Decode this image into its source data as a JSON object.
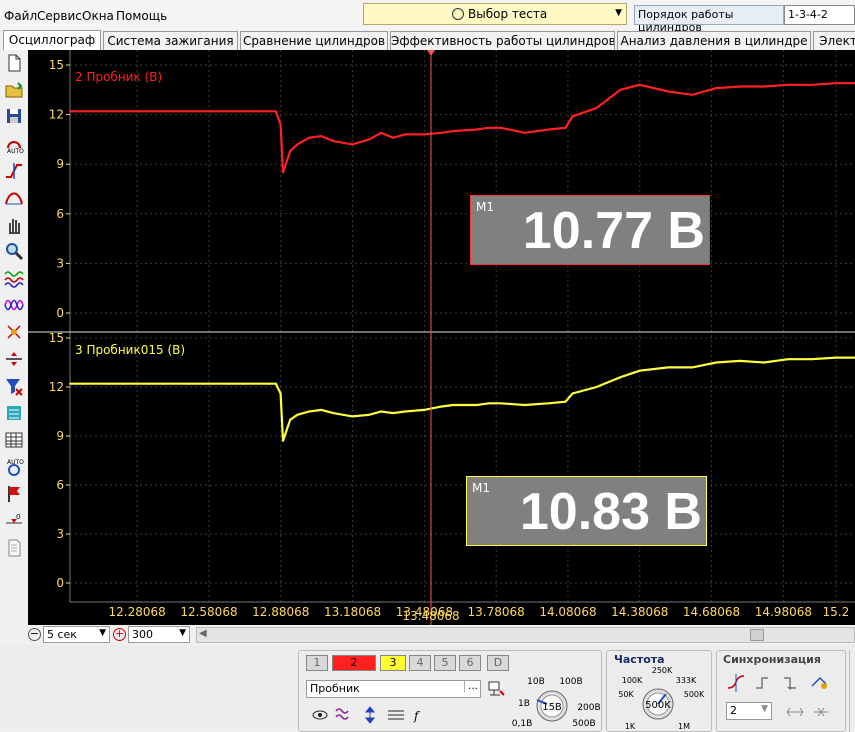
{
  "menu": {
    "file": "Файл",
    "service": "Сервис",
    "windows": "Окна",
    "help": "Помощь"
  },
  "test_select": {
    "label": "Выбор теста"
  },
  "cylinder_order": {
    "label": "Порядок работы цилиндров",
    "value": "1-3-4-2"
  },
  "tabs": [
    "Осциллограф",
    "Система зажигания",
    "Сравнение цилиндров",
    "Эффективность работы цилиндров",
    "Анализ давления в цилиндре",
    "Элект"
  ],
  "active_tab_index": 0,
  "channels": [
    {
      "name": "2 Пробник (В)",
      "color": "#ff2020",
      "marker": "M1",
      "value": "10.77 В"
    },
    {
      "name": "3 Пробник015 (В)",
      "color": "#ffff40",
      "marker": "M1",
      "value": "10.83 В"
    }
  ],
  "y_ticks": [
    "15",
    "12",
    "9",
    "6",
    "3",
    "0"
  ],
  "chart_data": [
    {
      "type": "line",
      "name": "2 Пробник (В)",
      "ylim": [
        0,
        15
      ],
      "xlim": [
        12.0,
        15.28
      ],
      "x_ticks": [
        "12.28068",
        "12.58068",
        "12.88068",
        "13.18068",
        "13.48068",
        "13.78068",
        "14.08068",
        "14.38068",
        "14.68068",
        "14.98068",
        "15.2"
      ],
      "x": [
        12.0,
        12.86,
        12.88,
        12.89,
        12.92,
        12.95,
        13.0,
        13.05,
        13.1,
        13.18,
        13.25,
        13.3,
        13.35,
        13.4,
        13.48,
        13.55,
        13.6,
        13.7,
        13.75,
        13.8,
        13.9,
        14.0,
        14.07,
        14.1,
        14.2,
        14.3,
        14.38,
        14.5,
        14.6,
        14.7,
        14.8,
        14.9,
        15.0,
        15.1,
        15.2,
        15.28
      ],
      "y": [
        12.2,
        12.2,
        11.4,
        8.5,
        9.8,
        10.2,
        10.6,
        10.7,
        10.4,
        10.2,
        10.5,
        10.9,
        10.6,
        10.8,
        10.8,
        10.9,
        11.0,
        11.1,
        11.2,
        11.2,
        10.9,
        11.1,
        11.2,
        11.9,
        12.4,
        13.5,
        13.8,
        13.4,
        13.2,
        13.6,
        13.7,
        13.7,
        13.8,
        13.8,
        13.9,
        13.9
      ]
    },
    {
      "type": "line",
      "name": "3 Пробник015 (В)",
      "ylim": [
        0,
        15
      ],
      "xlim": [
        12.0,
        15.28
      ],
      "x_ticks": [
        "12.28068",
        "12.58068",
        "12.88068",
        "13.18068",
        "13.48068",
        "13.78068",
        "14.08068",
        "14.38068",
        "14.68068",
        "14.98068",
        "15.2"
      ],
      "x": [
        12.0,
        12.86,
        12.88,
        12.89,
        12.92,
        12.95,
        13.0,
        13.05,
        13.1,
        13.18,
        13.25,
        13.3,
        13.35,
        13.4,
        13.48,
        13.55,
        13.6,
        13.7,
        13.75,
        13.8,
        13.9,
        14.0,
        14.07,
        14.1,
        14.2,
        14.3,
        14.38,
        14.5,
        14.6,
        14.7,
        14.8,
        14.9,
        15.0,
        15.1,
        15.2,
        15.28
      ],
      "y": [
        12.2,
        12.2,
        11.6,
        8.7,
        10.0,
        10.3,
        10.5,
        10.6,
        10.4,
        10.2,
        10.3,
        10.5,
        10.4,
        10.5,
        10.6,
        10.8,
        10.9,
        10.9,
        11.0,
        11.0,
        10.9,
        11.0,
        11.1,
        11.6,
        12.0,
        12.6,
        13.0,
        13.2,
        13.2,
        13.5,
        13.6,
        13.5,
        13.7,
        13.7,
        13.8,
        13.8
      ]
    }
  ],
  "cursor_time": "13.48068",
  "bottom_bar": {
    "timebase": "5 сек",
    "count": "300"
  },
  "channel_buttons": [
    "1",
    "2",
    "3",
    "4",
    "5",
    "6",
    "D"
  ],
  "probe_field": {
    "value": "Пробник"
  },
  "panel": {
    "frequency_title": "Частота",
    "sync_title": "Синхронизация",
    "volt_knob_center": "15В",
    "volt_labels": [
      "10В",
      "100В",
      "1В",
      "200В",
      "0,1В",
      "500В"
    ],
    "freq_knob_center": "500K",
    "freq_labels": [
      "250K",
      "100K",
      "333K",
      "50K",
      "500K",
      "1K",
      "1M"
    ],
    "sync_value": "2"
  }
}
